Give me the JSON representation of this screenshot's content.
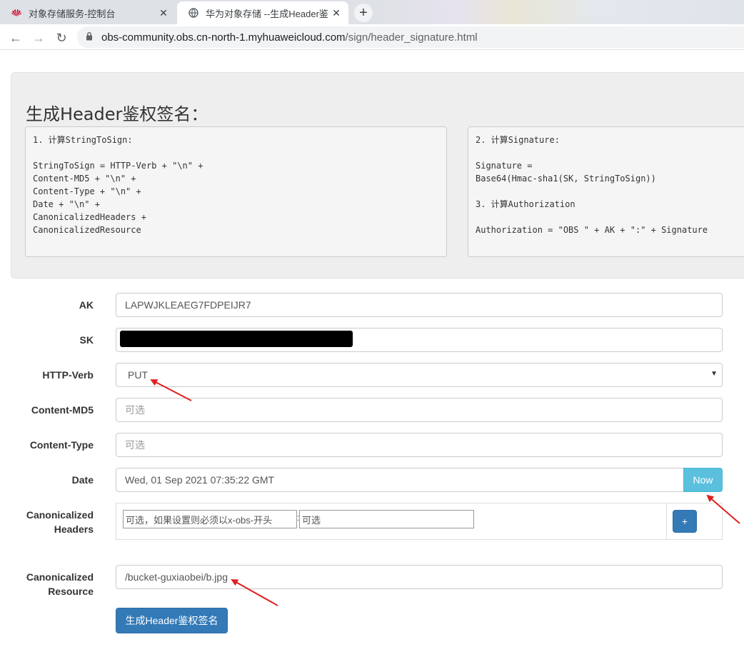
{
  "browser": {
    "tabs": [
      {
        "title": "对象存储服务-控制台",
        "icon": "huawei-logo-icon",
        "close": "✕"
      },
      {
        "title": "华为对象存储 --生成Header鉴权",
        "icon": "globe-icon",
        "close": "✕"
      }
    ],
    "new_tab": "+",
    "url_host": "obs-community.obs.cn-north-1.myhuaweicloud.com",
    "url_path": "/sign/header_signature.html",
    "back": "←",
    "forward": "→",
    "reload": "↻"
  },
  "page": {
    "title": "生成Header鉴权签名：",
    "code_left": "1. 计算StringToSign:\n\nStringToSign = HTTP-Verb + \"\\n\" +\nContent-MD5 + \"\\n\" +\nContent-Type + \"\\n\" +\nDate + \"\\n\" +\nCanonicalizedHeaders +\nCanonicalizedResource",
    "code_right": "2. 计算Signature:\n\nSignature =\nBase64(Hmac-sha1(SK, StringToSign))\n\n3. 计算Authorization\n\nAuthorization = \"OBS \" + AK + \":\" + Signature"
  },
  "form": {
    "ak": {
      "label": "AK",
      "value": "LAPWJKLEAEG7FDPEIJR7"
    },
    "sk": {
      "label": "SK"
    },
    "verb": {
      "label": "HTTP-Verb",
      "value": "PUT"
    },
    "md5": {
      "label": "Content-MD5",
      "placeholder": "可选"
    },
    "ctype": {
      "label": "Content-Type",
      "placeholder": "可选"
    },
    "date": {
      "label": "Date",
      "value": "Wed, 01 Sep 2021 07:35:22 GMT",
      "now_label": "Now"
    },
    "headers": {
      "label_line1": "Canonicalized",
      "label_line2": "Headers",
      "key_placeholder": "可选，如果设置则必须以x-obs-开头",
      "colon": ":",
      "value_placeholder": "可选",
      "add_label": "+"
    },
    "resource": {
      "label_line1": "Canonicalized",
      "label_line2": "Resource",
      "value": "/bucket-guxiaobei/b.jpg"
    },
    "submit_label": "生成Header鉴权签名"
  },
  "colors": {
    "primary": "#337ab7",
    "info": "#5bc0de",
    "annotation": "#e02020"
  }
}
